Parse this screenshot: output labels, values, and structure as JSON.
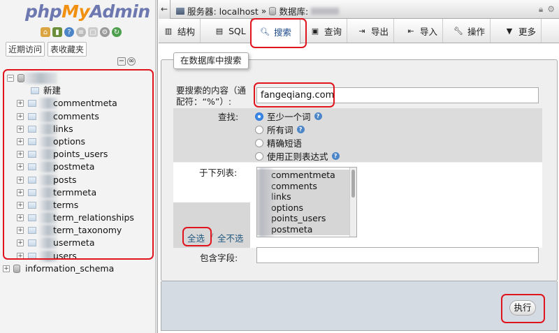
{
  "nav": {
    "logo_php": "php",
    "logo_my": "My",
    "logo_admin": "Admin",
    "icons": [
      "home-icon",
      "exit-icon",
      "help-icon",
      "docs-icon",
      "copy-icon",
      "settings-icon",
      "reload-icon"
    ],
    "recent_label": "近期访问",
    "favorites_label": "表收藏夹",
    "new_label": "新建",
    "tables": [
      "commentmeta",
      "comments",
      "links",
      "options",
      "points_users",
      "postmeta",
      "posts",
      "termmeta",
      "terms",
      "term_relationships",
      "term_taxonomy",
      "usermeta",
      "users"
    ],
    "other_db": "information_schema"
  },
  "breadcrumb": {
    "server_label": "服务器: localhost",
    "separator": "»",
    "database_label": "数据库:"
  },
  "tabs": [
    {
      "label": "结构",
      "icon": "structure-icon"
    },
    {
      "label": "SQL",
      "icon": "sql-icon"
    },
    {
      "label": "搜索",
      "icon": "search-icon",
      "active": true
    },
    {
      "label": "查询",
      "icon": "query-icon"
    },
    {
      "label": "导出",
      "icon": "export-icon"
    },
    {
      "label": "导入",
      "icon": "import-icon"
    },
    {
      "label": "操作",
      "icon": "wrench-icon"
    },
    {
      "label": "更多",
      "icon": "chevron-down-icon"
    }
  ],
  "search_form": {
    "legend": "在数据库中搜索",
    "term_label": "要搜索的内容（通配符：“%”）:",
    "term_value": "fangeqiang.com",
    "find_label": "查找:",
    "find_options": [
      "至少一个词",
      "所有词",
      "精确短语",
      "使用正则表达式"
    ],
    "find_selected": 0,
    "tables_label": "于下列表:",
    "table_options": [
      "commentmeta",
      "comments",
      "links",
      "options",
      "points_users",
      "postmeta"
    ],
    "select_all": "全选",
    "deselect_all": "全不选",
    "column_label": "包含字段:",
    "column_value": "",
    "submit_label": "执行"
  },
  "colors": {
    "highlight": "#e0141c",
    "radio_checked": "#3b88e6",
    "link": "#235a81"
  }
}
